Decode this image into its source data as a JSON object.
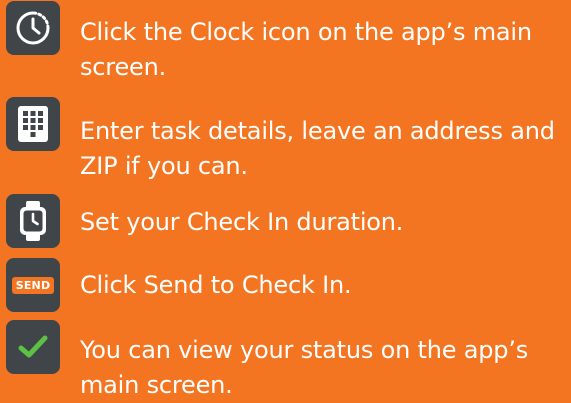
{
  "colors": {
    "background": "#F47521",
    "icon_tile": "#3f4548",
    "text": "#ffffff",
    "check_green": "#5cc144"
  },
  "steps": [
    {
      "icon": "clock-icon",
      "text": "Click the Clock icon on the app’s main screen."
    },
    {
      "icon": "keypad-icon",
      "text": "Enter task details, leave an address and ZIP if you can."
    },
    {
      "icon": "watch-icon",
      "text": "Set your Check In duration."
    },
    {
      "icon": "send-icon",
      "icon_label": "SEND",
      "text": "Click Send to Check In."
    },
    {
      "icon": "checkmark-icon",
      "text": "You can view your status on the app’s main screen."
    }
  ]
}
